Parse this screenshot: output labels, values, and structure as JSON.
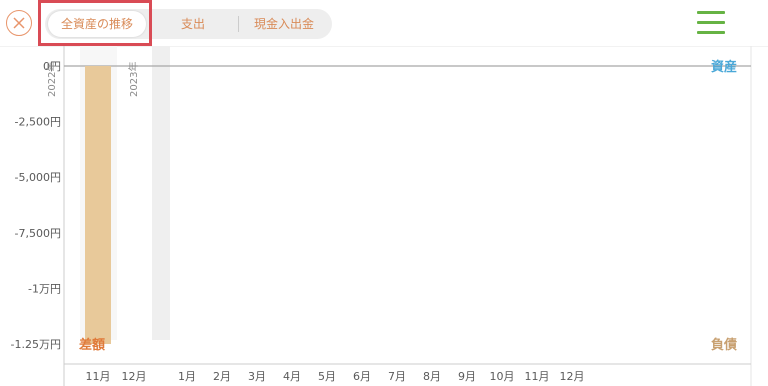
{
  "header": {
    "tabs": [
      {
        "label": "全資産の推移",
        "active": true
      },
      {
        "label": "支出",
        "active": false
      },
      {
        "label": "現金入出金",
        "active": false
      }
    ]
  },
  "chart_data": {
    "type": "bar",
    "y_ticks": [
      "0円",
      "-2,500円",
      "-5,000円",
      "-7,500円",
      "-1万円",
      "-1.25万円"
    ],
    "ylim": [
      -12500,
      0
    ],
    "years": [
      "2022年",
      "2023年"
    ],
    "categories": [
      "11月",
      "12月",
      "1月",
      "2月",
      "3月",
      "4月",
      "5月",
      "6月",
      "7月",
      "8月",
      "9月",
      "10月",
      "11月",
      "12月"
    ],
    "values": [
      -12500,
      0,
      0,
      0,
      0,
      0,
      0,
      0,
      0,
      0,
      0,
      0,
      0,
      0
    ],
    "labels": {
      "assets": "資産",
      "liabilities": "負債",
      "difference": "差額"
    },
    "colors": {
      "bar": "#e8c99a",
      "assets": "#4aa8d8",
      "liabilities": "#c8a070",
      "difference": "#e07a3a"
    }
  }
}
